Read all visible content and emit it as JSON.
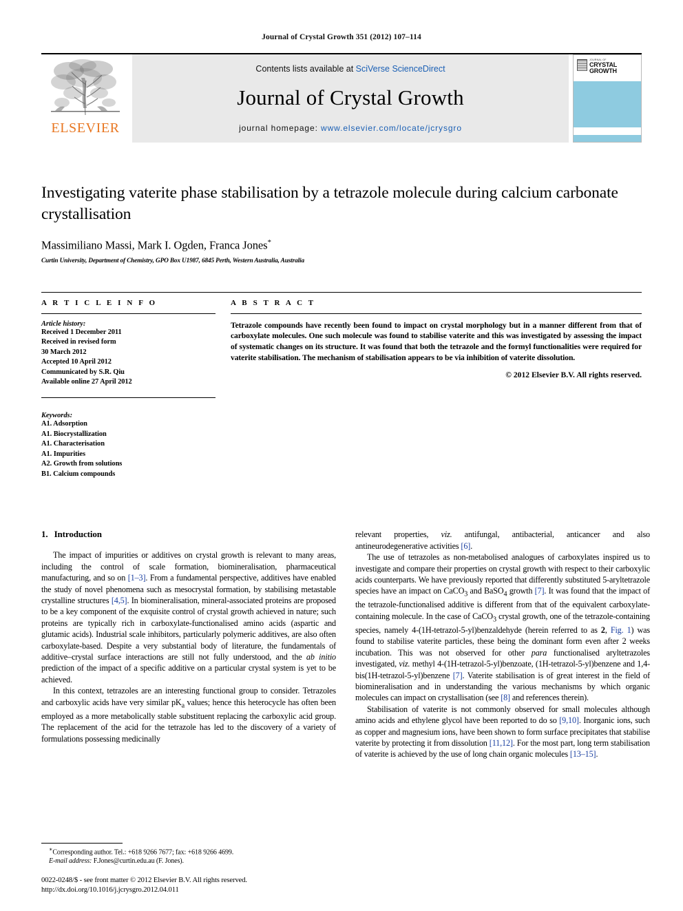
{
  "running_head": "Journal of Crystal Growth 351 (2012) 107–114",
  "masthead": {
    "publisher_name": "ELSEVIER",
    "contents_prefix": "Contents lists available at ",
    "contents_link": "SciVerse ScienceDirect",
    "journal_title": "Journal of Crystal Growth",
    "homepage_prefix": "journal homepage: ",
    "homepage_link": "www.elsevier.com/locate/jcrysgro",
    "cover": {
      "sub": "JOURNAL OF",
      "main_line1": "CRYSTAL",
      "main_line2": "GROWTH"
    }
  },
  "article": {
    "title": "Investigating vaterite phase stabilisation by a tetrazole molecule during calcium carbonate crystallisation",
    "authors": "Massimiliano Massi, Mark I. Ogden, Franca Jones",
    "corresponding_marker": "*",
    "affiliation": "Curtin University, Department of Chemistry, GPO Box U1987, 6845 Perth, Western Australia, Australia"
  },
  "article_info": {
    "heading": "A R T I C L E   I N F O",
    "history_label": "Article history:",
    "history": [
      "Received 1 December 2011",
      "Received in revised form",
      "30 March 2012",
      "Accepted 10 April 2012",
      "Communicated by S.R. Qiu",
      "Available online 27 April 2012"
    ],
    "keywords_label": "Keywords:",
    "keywords": [
      "A1. Adsorption",
      "A1. Biocrystallization",
      "A1. Characterisation",
      "A1. Impurities",
      "A2. Growth from solutions",
      "B1. Calcium compounds"
    ]
  },
  "abstract": {
    "heading": "A B S T R A C T",
    "text": "Tetrazole compounds have recently been found to impact on crystal morphology but in a manner different from that of carboxylate molecules. One such molecule was found to stabilise vaterite and this was investigated by assessing the impact of systematic changes on its structure. It was found that both the tetrazole and the formyl functionalities were required for vaterite stabilisation. The mechanism of stabilisation appears to be via inhibition of vaterite dissolution.",
    "copyright": "© 2012 Elsevier B.V. All rights reserved."
  },
  "body": {
    "section_number": "1.",
    "section_title": "Introduction",
    "left_para_1_a": "The impact of impurities or additives on crystal growth is relevant to many areas, including the control of scale formation, biomineralisation, pharmaceutical manufacturing, and so on ",
    "ref_1_3": "[1–3]",
    "left_para_1_b": ". From a fundamental perspective, additives have enabled the study of novel phenomena such as mesocrystal formation, by stabilising metastable crystalline structures ",
    "ref_4_5": "[4,5]",
    "left_para_1_c": ". In biomineralisation, mineral-associated proteins are proposed to be a key component of the exquisite control of crystal growth achieved in nature; such proteins are typically rich in carboxylate-functionalised amino acids (aspartic and glutamic acids). Industrial scale inhibitors, particularly polymeric additives, are also often carboxylate-based. Despite a very substantial body of literature, the fundamentals of additive–crystal surface interactions are still not fully understood, and the ",
    "ab_initio": "ab initio",
    "left_para_1_d": " prediction of the impact of a specific additive on a particular crystal system is yet to be achieved.",
    "left_para_2_a": "In this context, tetrazoles are an interesting functional group to consider. Tetrazoles and carboxylic acids have very similar pK",
    "pka_sub": "a",
    "left_para_2_b": " values; hence this heterocycle has often been employed as a more metabolically stable substituent replacing the carboxylic acid group. The replacement of the acid for the tetrazole has led to the discovery of a variety of formulations possessing medicinally",
    "right_para_1_a": "relevant properties, ",
    "viz_1": "viz.",
    "right_para_1_b": " antifungal, antibacterial, anticancer and also antineurodegenerative activities ",
    "ref_6": "[6]",
    "right_para_1_c": ".",
    "right_para_2_a": "The use of tetrazoles as non-metabolised analogues of carboxylates inspired us to investigate and compare their properties on crystal growth with respect to their carboxylic acids counterparts. We have previously reported that differently substituted 5-aryltetrazole species have an impact on CaCO",
    "sub_3_a": "3",
    "right_para_2_b": " and BaSO",
    "sub_4": "4",
    "right_para_2_c": " growth ",
    "ref_7_a": "[7]",
    "right_para_2_d": ". It was found that the impact of the tetrazole-functionalised additive is different from that of the equivalent carboxylate-containing molecule. In the case of CaCO",
    "sub_3_b": "3",
    "right_para_2_e": " crystal growth, one of the tetrazole-containing species, namely 4-(1H-tetrazol-5-yl)benzaldehyde (herein referred to as ",
    "bold_2": "2",
    "right_para_2_f": ", ",
    "fig_1_link": "Fig. 1",
    "right_para_2_g": ") was found to stabilise vaterite particles, these being the dominant form even after 2 weeks incubation. This was not observed for other ",
    "para_italic": "para",
    "right_para_2_h": " functionalised aryltetrazoles investigated, ",
    "viz_2": "viz.",
    "right_para_2_i": " methyl 4-(1H-tetrazol-5-yl)benzoate, (1H-tetrazol-5-yl)benzene and 1,4-bis(1H-tetrazol-5-yl)benzene ",
    "ref_7_b": "[7]",
    "right_para_2_j": ". Vaterite stabilisation is of great interest in the field of biomineralisation and in understanding the various mechanisms by which organic molecules can impact on crystallisation (see ",
    "ref_8": "[8]",
    "right_para_2_k": " and references therein).",
    "right_para_3_a": "Stabilisation of vaterite is not commonly observed for small molecules although amino acids and ethylene glycol have been reported to do so ",
    "ref_9_10": "[9,10]",
    "right_para_3_b": ". Inorganic ions, such as copper and magnesium ions, have been shown to form surface precipitates that stabilise vaterite by protecting it from dissolution ",
    "ref_11_12": "[11,12]",
    "right_para_3_c": ". For the most part, long term stabilisation of vaterite is achieved by the use of long chain organic molecules ",
    "ref_13_15": "[13–15]",
    "right_para_3_d": "."
  },
  "footnotes": {
    "corresponding": "Corresponding author. Tel.: +618 9266 7677; fax: +618 9266 4699.",
    "email_label": "E-mail address:",
    "email_value": " F.Jones@curtin.edu.au (F. Jones).",
    "issn_line": "0022-0248/$ - see front matter © 2012 Elsevier B.V. All rights reserved.",
    "doi_line": "http://dx.doi.org/10.1016/j.jcrysgro.2012.04.011"
  },
  "colors": {
    "link": "#1a5fb4",
    "reference": "#1a3fa0",
    "elsevier_orange": "#E87722",
    "cover_blue": "#8ecbe0",
    "banner_gray": "#e9e9e9"
  }
}
